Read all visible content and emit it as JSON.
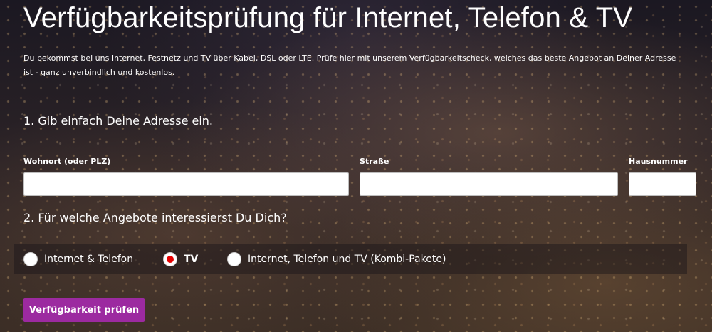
{
  "page": {
    "title": "Verfügbarkeitsprüfung für Internet, Telefon & TV",
    "intro": "Du bekommst bei uns Internet, Festnetz und TV über Kabel, DSL oder LTE. Prüfe hier mit unserem Verfügbarkeitscheck, welches das beste Angebot an Deiner Adresse ist - ganz unverbindlich und kostenlos."
  },
  "address": {
    "heading": "1. Gib einfach Deine Adresse ein.",
    "fields": [
      {
        "label": "Wohnort (oder PLZ)",
        "value": "",
        "placeholder": ""
      },
      {
        "label": "Straße",
        "value": "",
        "placeholder": ""
      },
      {
        "label": "Hausnummer",
        "value": "",
        "placeholder": ""
      }
    ]
  },
  "offers": {
    "heading": "2. Für welche Angebote interessierst Du Dich?",
    "options": [
      {
        "label": "Internet & Telefon",
        "selected": false
      },
      {
        "label": "TV",
        "selected": true
      },
      {
        "label": "Internet, Telefon und TV (Kombi-Pakete)",
        "selected": false
      }
    ],
    "selected_label": "TV"
  },
  "submit": {
    "label": "Verfügbarkeit prüfen"
  },
  "colors": {
    "accent_button": "#9c2aa0",
    "radio_selected": "#e60000",
    "text": "#ffffff"
  }
}
